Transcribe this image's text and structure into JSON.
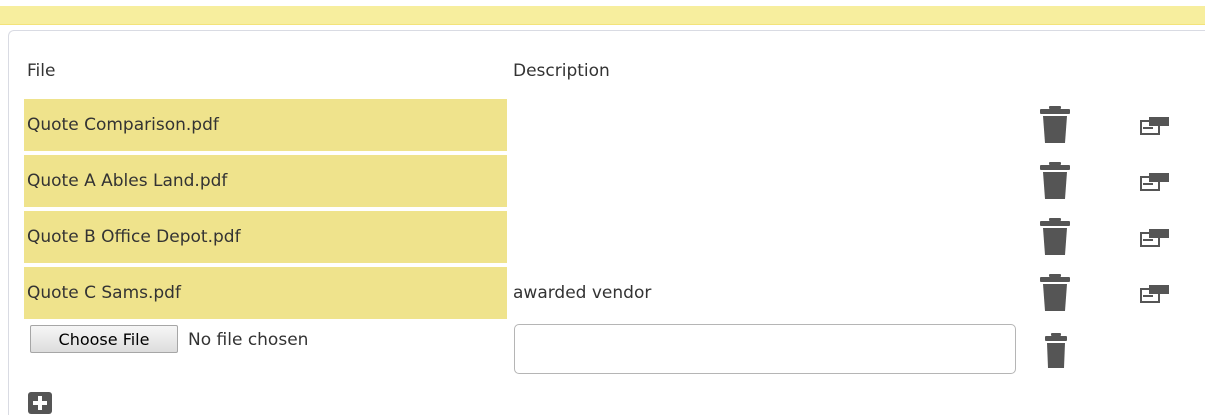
{
  "headers": {
    "file": "File",
    "description": "Description"
  },
  "attachments": [
    {
      "file": "Quote Comparison.pdf",
      "description": ""
    },
    {
      "file": "Quote A Ables Land.pdf",
      "description": ""
    },
    {
      "file": "Quote B Office Depot.pdf",
      "description": ""
    },
    {
      "file": "Quote C Sams.pdf",
      "description": "awarded vendor"
    }
  ],
  "new_row": {
    "choose_label": "Choose File",
    "status": "No file chosen",
    "description_value": ""
  },
  "icons": {
    "delete": "trash-icon",
    "edit": "edit-icon",
    "add": "plus-icon"
  },
  "colors": {
    "file_cell": "#efe38c",
    "banner": "#f7ee9e",
    "icon": "#555555"
  }
}
